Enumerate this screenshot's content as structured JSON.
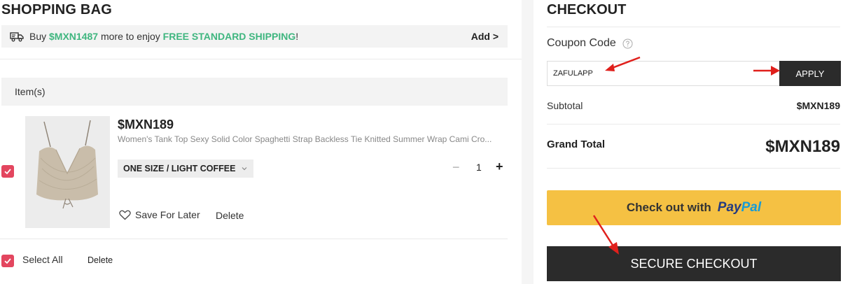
{
  "bag": {
    "title": "SHOPPING BAG",
    "shipping": {
      "prefix": "Buy ",
      "amount": "$MXN1487",
      "middle": " more to enjoy ",
      "highlight": "FREE STANDARD SHIPPING",
      "suffix": "!",
      "add_label": "Add >"
    },
    "items_header": "Item(s)",
    "item": {
      "price": "$MXN189",
      "name": "Women's Tank Top Sexy Solid Color Spaghetti Strap Backless Tie Knitted Summer Wrap Cami Cro...",
      "variant": "ONE SIZE / LIGHT COFFEE",
      "quantity": "1",
      "qty_minus": "−",
      "qty_plus": "+",
      "save_for_later": "Save For Later",
      "delete": "Delete",
      "checked": true
    },
    "select_all": "Select All",
    "delete_all": "Delete"
  },
  "checkout": {
    "title": "CHECKOUT",
    "coupon_label": "Coupon Code",
    "coupon_value": "ZAFULAPP",
    "apply_label": "APPLY",
    "subtotal_label": "Subtotal",
    "subtotal_value": "$MXN189",
    "grand_label": "Grand Total",
    "grand_value": "$MXN189",
    "paypal_label": "Check out with",
    "paypal_pay": "Pay",
    "paypal_pal": "Pal",
    "secure_label": "SECURE CHECKOUT"
  },
  "colors": {
    "accent_green": "#3fb67f",
    "checkbox_red": "#e3465f",
    "paypal_yellow": "#f5c143",
    "dark_button": "#2b2b2b",
    "annotation_arrow": "#e0201c"
  }
}
